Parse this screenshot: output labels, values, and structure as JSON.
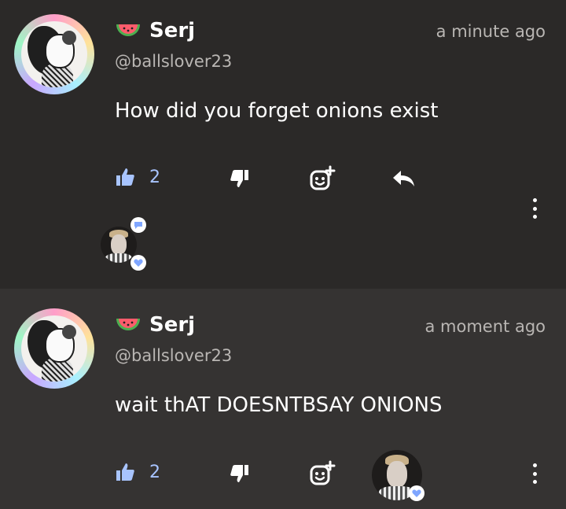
{
  "comments": [
    {
      "author": "Serj",
      "handle": "@ballslover23",
      "time": "a minute ago",
      "text": "How did you forget onions exist",
      "likes": "2"
    },
    {
      "author": "Serj",
      "handle": "@ballslover23",
      "time": "a moment ago",
      "text": "wait thAT DOESNTBSAY ONIONS",
      "likes": "2"
    }
  ],
  "icons": {
    "like": "thumbs-up-icon",
    "dislike": "thumbs-down-icon",
    "react": "add-emoji-icon",
    "reply": "reply-icon",
    "more": "more-vertical-icon",
    "author_badge": "watermelon-icon"
  },
  "colors": {
    "accent": "#a8c4ff",
    "background": "#2b2928",
    "background_alt": "#353332",
    "muted_text": "#b9b6b3"
  }
}
